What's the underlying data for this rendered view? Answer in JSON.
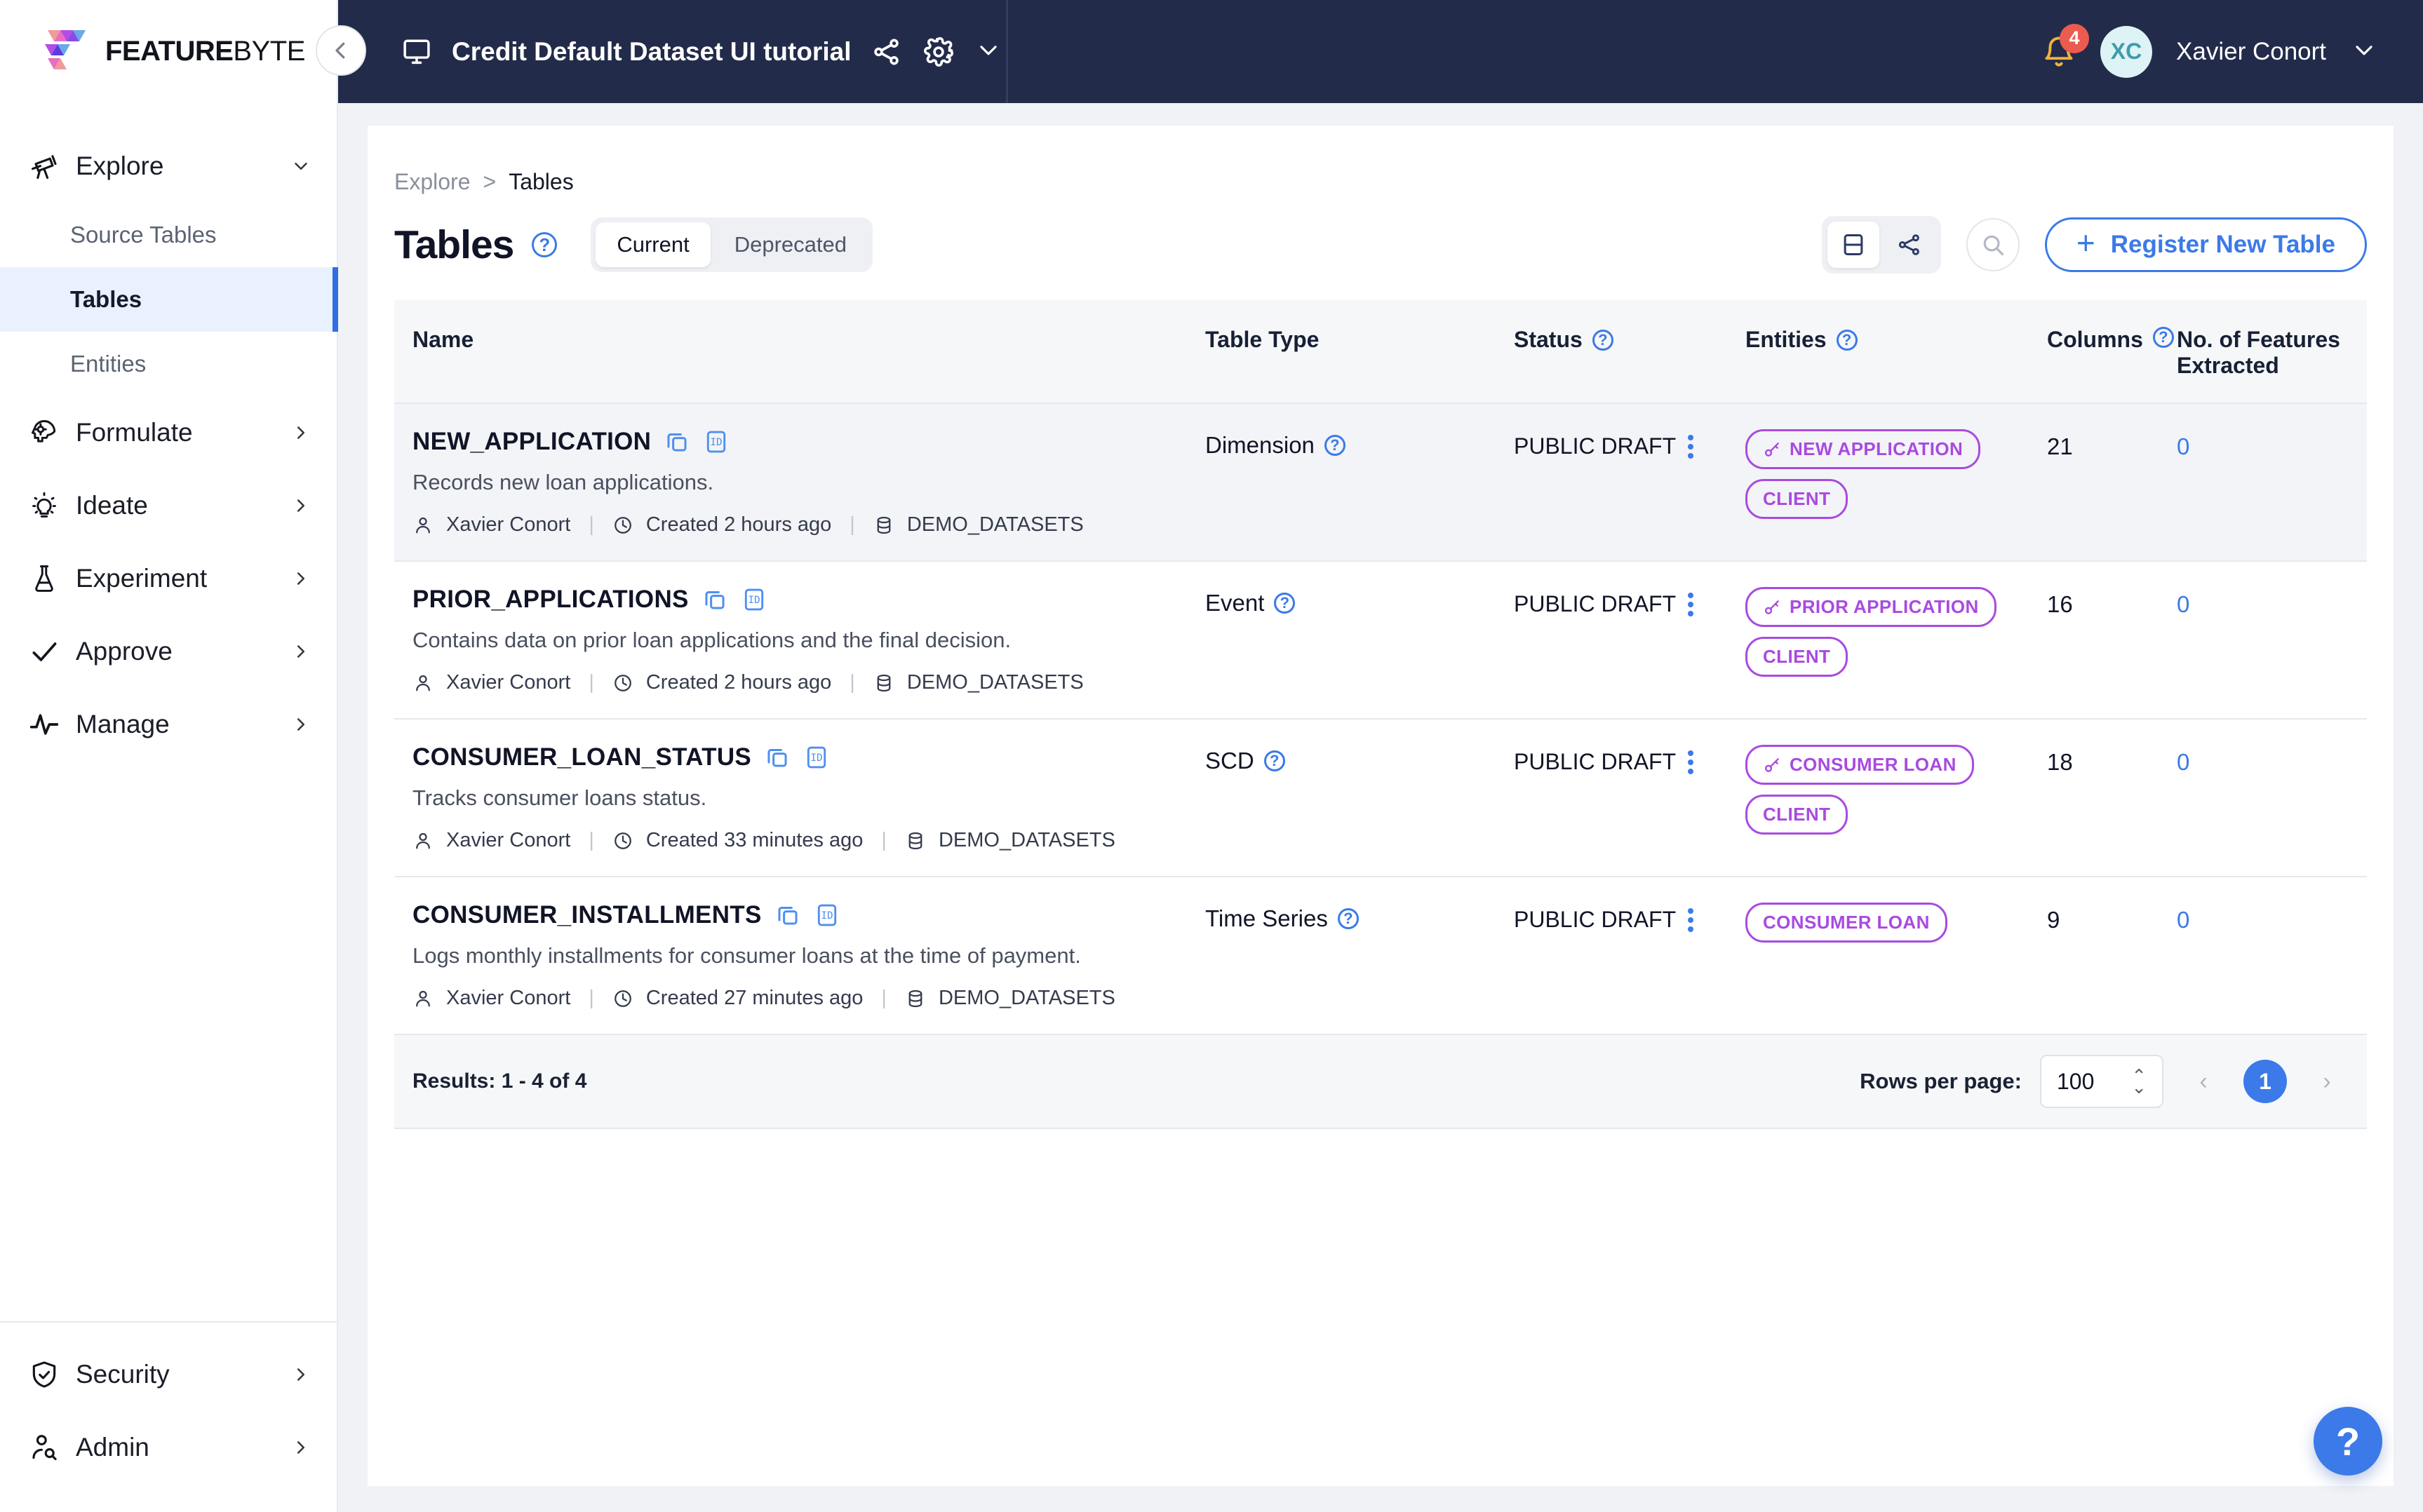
{
  "brand": {
    "name_bold": "FEATURE",
    "name_light": "BYTE",
    "logo_icon": "featurebyte-logo-icon",
    "collapse_icon": "chevron-left-icon"
  },
  "topbar": {
    "monitor_icon": "monitor-icon",
    "project_title": "Credit Default Dataset UI tutorial",
    "share_icon": "share-nodes-icon",
    "settings_icon": "gear-icon",
    "chevron_icon": "chevron-down-icon",
    "bell_icon": "bell-icon",
    "notification_count": "4",
    "avatar_initials": "XC",
    "user_name": "Xavier Conort",
    "user_chevron_icon": "chevron-down-icon"
  },
  "sidebar": {
    "groups": [
      {
        "label": "Explore",
        "icon": "telescope-icon",
        "chevron": "chevron-down-icon",
        "expanded": true,
        "children": [
          {
            "label": "Source Tables",
            "active": false
          },
          {
            "label": "Tables",
            "active": true
          },
          {
            "label": "Entities",
            "active": false
          }
        ]
      },
      {
        "label": "Formulate",
        "icon": "brain-gear-icon",
        "chevron": "chevron-right-icon",
        "expanded": false,
        "children": []
      },
      {
        "label": "Ideate",
        "icon": "lightbulb-icon",
        "chevron": "chevron-right-icon",
        "expanded": false,
        "children": []
      },
      {
        "label": "Experiment",
        "icon": "flask-icon",
        "chevron": "chevron-right-icon",
        "expanded": false,
        "children": []
      },
      {
        "label": "Approve",
        "icon": "check-icon",
        "chevron": "chevron-right-icon",
        "expanded": false,
        "children": []
      },
      {
        "label": "Manage",
        "icon": "pulse-icon",
        "chevron": "chevron-right-icon",
        "expanded": false,
        "children": []
      }
    ],
    "bottom": [
      {
        "label": "Security",
        "icon": "shield-check-icon",
        "chevron": "chevron-right-icon"
      },
      {
        "label": "Admin",
        "icon": "user-search-icon",
        "chevron": "chevron-right-icon"
      }
    ]
  },
  "breadcrumb": {
    "parent": "Explore",
    "separator": ">",
    "current": "Tables"
  },
  "header": {
    "title": "Tables",
    "help_icon": "question-circle-icon",
    "tabs": [
      {
        "label": "Current",
        "active": true
      },
      {
        "label": "Deprecated",
        "active": false
      }
    ],
    "view_toggle": [
      {
        "icon": "table-view-icon",
        "active": true
      },
      {
        "icon": "graph-view-icon",
        "active": false
      }
    ],
    "search_icon": "search-icon",
    "register_button": {
      "label": "Register New Table",
      "icon": "plus-icon"
    }
  },
  "table": {
    "columns": [
      {
        "label": "Name",
        "help": false
      },
      {
        "label": "Table Type",
        "help": false
      },
      {
        "label": "Status",
        "help": true
      },
      {
        "label": "Entities",
        "help": true
      },
      {
        "label": "Columns",
        "help": true
      },
      {
        "label": "No. of Features Extracted",
        "help": false
      }
    ],
    "rows": [
      {
        "name": "NEW_APPLICATION",
        "copy_icon": "copy-icon",
        "id_icon": "id-icon",
        "description": "Records new loan applications.",
        "author": "Xavier Conort",
        "author_icon": "user-icon",
        "created": "Created 2 hours ago",
        "created_icon": "clock-icon",
        "source": "DEMO_DATASETS",
        "source_icon": "database-icon",
        "type": "Dimension",
        "type_help_icon": "question-circle-icon",
        "status": "PUBLIC DRAFT",
        "status_menu_icon": "kebab-menu-icon",
        "entities": [
          {
            "label": "NEW APPLICATION",
            "primary": true,
            "key_icon": "key-icon"
          },
          {
            "label": "CLIENT",
            "primary": false
          }
        ],
        "columns_count": "21",
        "features_extracted": "0"
      },
      {
        "name": "PRIOR_APPLICATIONS",
        "copy_icon": "copy-icon",
        "id_icon": "id-icon",
        "description": "Contains data on prior loan applications and the final decision.",
        "author": "Xavier Conort",
        "author_icon": "user-icon",
        "created": "Created 2 hours ago",
        "created_icon": "clock-icon",
        "source": "DEMO_DATASETS",
        "source_icon": "database-icon",
        "type": "Event",
        "type_help_icon": "question-circle-icon",
        "status": "PUBLIC DRAFT",
        "status_menu_icon": "kebab-menu-icon",
        "entities": [
          {
            "label": "PRIOR APPLICATION",
            "primary": true,
            "key_icon": "key-icon"
          },
          {
            "label": "CLIENT",
            "primary": false
          }
        ],
        "columns_count": "16",
        "features_extracted": "0"
      },
      {
        "name": "CONSUMER_LOAN_STATUS",
        "copy_icon": "copy-icon",
        "id_icon": "id-icon",
        "description": "Tracks consumer loans status.",
        "author": "Xavier Conort",
        "author_icon": "user-icon",
        "created": "Created 33 minutes ago",
        "created_icon": "clock-icon",
        "source": "DEMO_DATASETS",
        "source_icon": "database-icon",
        "type": "SCD",
        "type_help_icon": "question-circle-icon",
        "status": "PUBLIC DRAFT",
        "status_menu_icon": "kebab-menu-icon",
        "entities": [
          {
            "label": "CONSUMER LOAN",
            "primary": true,
            "key_icon": "key-icon"
          },
          {
            "label": "CLIENT",
            "primary": false
          }
        ],
        "columns_count": "18",
        "features_extracted": "0"
      },
      {
        "name": "CONSUMER_INSTALLMENTS",
        "copy_icon": "copy-icon",
        "id_icon": "id-icon",
        "description": "Logs monthly installments for consumer loans at the time of payment.",
        "author": "Xavier Conort",
        "author_icon": "user-icon",
        "created": "Created 27 minutes ago",
        "created_icon": "clock-icon",
        "source": "DEMO_DATASETS",
        "source_icon": "database-icon",
        "type": "Time Series",
        "type_help_icon": "question-circle-icon",
        "status": "PUBLIC DRAFT",
        "status_menu_icon": "kebab-menu-icon",
        "entities": [
          {
            "label": "CONSUMER LOAN",
            "primary": false
          }
        ],
        "columns_count": "9",
        "features_extracted": "0"
      }
    ]
  },
  "footer": {
    "results": "Results: 1 - 4 of 4",
    "rows_per_page_label": "Rows per page:",
    "rows_per_page_value": "100",
    "prev_icon": "chevron-left-icon",
    "next_icon": "chevron-right-icon",
    "current_page": "1"
  },
  "help_fab": {
    "label": "?",
    "icon": "question-icon"
  },
  "colors": {
    "accent": "#3b7ae8",
    "topbar": "#232b4a",
    "entity": "#a94ae0",
    "badge": "#ea5b50",
    "active_nav": "#e8f1fd"
  }
}
